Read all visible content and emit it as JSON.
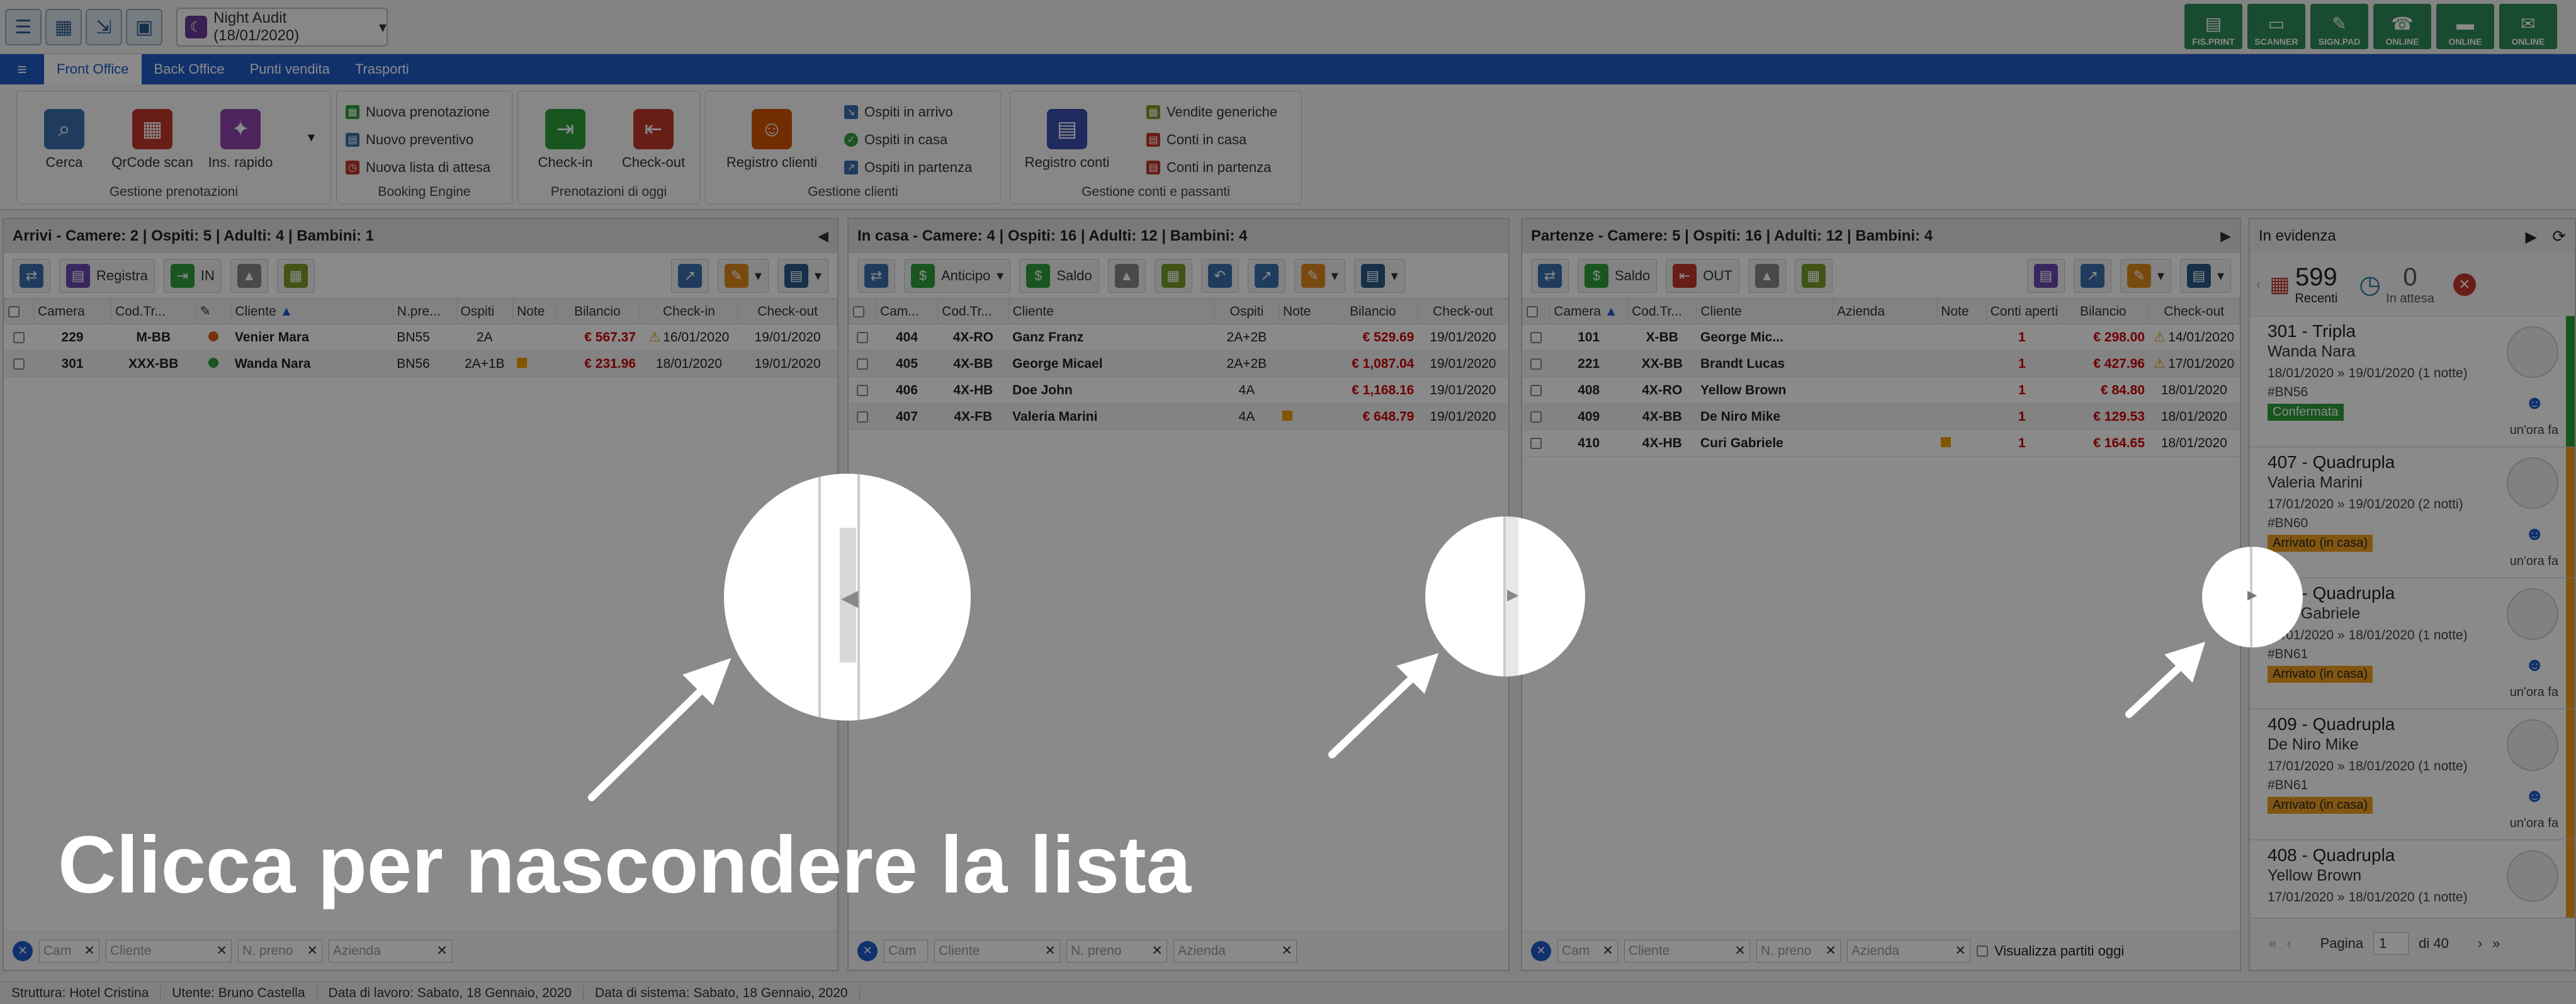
{
  "topbar": {
    "audit_label": "Night Audit (18/01/2020)",
    "devices": [
      "FIS.PRINT",
      "SCANNER",
      "SIGN.PAD",
      "ONLINE",
      "ONLINE",
      "ONLINE"
    ]
  },
  "nav": {
    "tabs": [
      "Front Office",
      "Back Office",
      "Punti vendita",
      "Trasporti"
    ]
  },
  "ribbon": {
    "gestione": {
      "label": "Gestione prenotazioni",
      "cerca": "Cerca",
      "qrcode": "QrCode scan",
      "ins": "Ins. rapido"
    },
    "booking": {
      "label": "Booking Engine",
      "items": [
        "Nuova prenotazione",
        "Nuovo preventivo",
        "Nuova lista di attesa"
      ]
    },
    "oggi": {
      "label": "Prenotazioni di oggi",
      "checkin": "Check-in",
      "checkout": "Check-out"
    },
    "clienti": {
      "label": "Gestione clienti",
      "registro": "Registro clienti",
      "items": [
        "Ospiti in arrivo",
        "Ospiti in casa",
        "Ospiti in partenza"
      ]
    },
    "conti": {
      "label": "Gestione conti e passanti",
      "registro": "Registro conti",
      "items": [
        "Vendite generiche",
        "Conti in casa",
        "Conti in partenza"
      ]
    }
  },
  "arrivi": {
    "title": "Arrivi - Camere: 2 | Ospiti: 5 | Adulti: 4 | Bambini: 1",
    "registra": "Registra",
    "in": "IN",
    "headers": [
      "Camera",
      "Cod.Tr...",
      "Cliente",
      "N.pre...",
      "Ospiti",
      "Note",
      "Bilancio",
      "Check-in",
      "Check-out"
    ],
    "rows": [
      {
        "camera": "229",
        "cod": "M-BB",
        "cliente": "Venier Mara",
        "npre": "BN55",
        "ospiti": "2A",
        "bilancio": "€ 567.37",
        "checkin": "16/01/2020",
        "checkout": "19/01/2020"
      },
      {
        "camera": "301",
        "cod": "XXX-BB",
        "cliente": "Wanda Nara",
        "npre": "BN56",
        "ospiti": "2A+1B",
        "bilancio": "€ 231.96",
        "checkin": "18/01/2020",
        "checkout": "19/01/2020"
      }
    ]
  },
  "incasa": {
    "title": "In casa - Camere: 4 | Ospiti: 16 | Adulti: 12 | Bambini: 4",
    "anticipo": "Anticipo",
    "saldo": "Saldo",
    "headers": [
      "Cam...",
      "Cod.Tr...",
      "Cliente",
      "Ospiti",
      "Note",
      "Bilancio",
      "Check-out"
    ],
    "rows": [
      {
        "camera": "404",
        "cod": "4X-RO",
        "cliente": "Ganz Franz",
        "ospiti": "2A+2B",
        "bilancio": "€ 529.69",
        "checkout": "19/01/2020"
      },
      {
        "camera": "405",
        "cod": "4X-BB",
        "cliente": "George Micael",
        "ospiti": "2A+2B",
        "bilancio": "€ 1,087.04",
        "checkout": "19/01/2020"
      },
      {
        "camera": "406",
        "cod": "4X-HB",
        "cliente": "Doe John",
        "ospiti": "4A",
        "bilancio": "€ 1,168.16",
        "checkout": "19/01/2020"
      },
      {
        "camera": "407",
        "cod": "4X-FB",
        "cliente": "Valeria Marini",
        "ospiti": "4A",
        "bilancio": "€ 648.79",
        "checkout": "19/01/2020"
      }
    ]
  },
  "partenze": {
    "title": "Partenze - Camere: 5 | Ospiti: 16 | Adulti: 12 | Bambini: 4",
    "saldo": "Saldo",
    "out": "OUT",
    "headers": [
      "Camera",
      "Cod.Tr...",
      "Cliente",
      "Azienda",
      "Note",
      "Conti aperti",
      "Bilancio",
      "Check-out"
    ],
    "rows": [
      {
        "camera": "101",
        "cod": "X-BB",
        "cliente": "George Mic...",
        "conti": "1",
        "bilancio": "€ 298.00",
        "checkout": "14/01/2020"
      },
      {
        "camera": "221",
        "cod": "XX-BB",
        "cliente": "Brandt Lucas",
        "conti": "1",
        "bilancio": "€ 427.96",
        "checkout": "17/01/2020"
      },
      {
        "camera": "408",
        "cod": "4X-RO",
        "cliente": "Yellow Brown",
        "conti": "1",
        "bilancio": "€ 84.80",
        "checkout": "18/01/2020"
      },
      {
        "camera": "409",
        "cod": "4X-BB",
        "cliente": "De Niro Mike",
        "conti": "1",
        "bilancio": "€ 129.53",
        "checkout": "18/01/2020"
      },
      {
        "camera": "410",
        "cod": "4X-HB",
        "cliente": "Curi Gabriele",
        "conti": "1",
        "bilancio": "€ 164.65",
        "checkout": "18/01/2020"
      }
    ],
    "visualizza": "Visualizza partiti oggi"
  },
  "filters": {
    "camera": "Cam",
    "cliente": "Cliente",
    "npreno": "N. preno",
    "azienda": "Azienda"
  },
  "evidenza": {
    "title": "In evidenza",
    "recenti_count": "599",
    "recenti": "Recenti",
    "attesa_count": "0",
    "attesa": "In attesa",
    "cards": [
      {
        "title": "301 - Tripla",
        "name": "Wanda Nara",
        "dates": "18/01/2020 » 19/01/2020 (1 notte)",
        "code": "#BN56",
        "badge": "Confermata",
        "ago": "un'ora fa"
      },
      {
        "title": "407 - Quadrupla",
        "name": "Valeria Marini",
        "dates": "17/01/2020 » 19/01/2020 (2 notti)",
        "code": "#BN60",
        "badge": "Arrivato (in casa)",
        "ago": "un'ora fa"
      },
      {
        "title": "410 - Quadrupla",
        "name": "Curi Gabriele",
        "dates": "17/01/2020 » 18/01/2020 (1 notte)",
        "code": "#BN61",
        "badge": "Arrivato (in casa)",
        "ago": "un'ora fa"
      },
      {
        "title": "409 - Quadrupla",
        "name": "De Niro Mike",
        "dates": "17/01/2020 » 18/01/2020 (1 notte)",
        "code": "#BN61",
        "badge": "Arrivato (in casa)",
        "ago": "un'ora fa"
      },
      {
        "title": "408 - Quadrupla",
        "name": "Yellow Brown",
        "dates": "17/01/2020 » 18/01/2020 (1 notte)",
        "code": "",
        "badge": "",
        "ago": ""
      }
    ],
    "pager_label": "Pagina",
    "page": "1",
    "of": "di 40"
  },
  "status": {
    "struttura": "Struttura: Hotel Cristina",
    "utente": "Utente: Bruno Castella",
    "lavoro": "Data di lavoro: Sabato, 18 Gennaio, 2020",
    "sistema": "Data di sistema: Sabato, 18 Gennaio, 2020"
  },
  "caption": "Clicca per nascondere la lista",
  "colors": {
    "nav": "#1e5cc8",
    "balance": "#cc0000",
    "confermata": "#2e9d3a",
    "arrivato": "#f0a020"
  }
}
